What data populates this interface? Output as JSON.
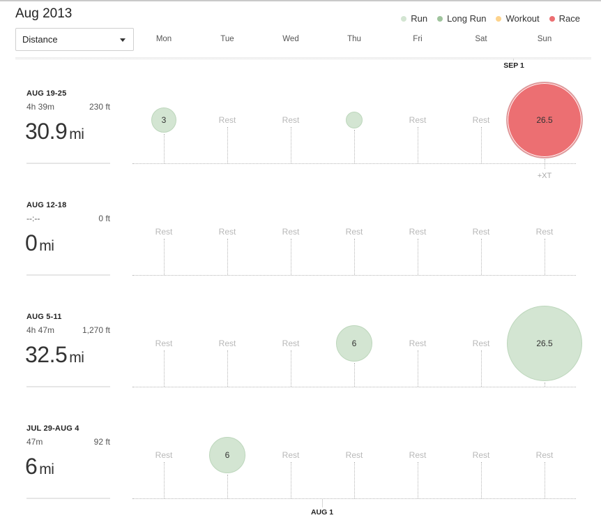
{
  "header": {
    "title": "Aug 2013",
    "metric_select": {
      "value": "Distance",
      "icon": "caret-down-icon"
    },
    "days": [
      "Mon",
      "Tue",
      "Wed",
      "Thu",
      "Fri",
      "Sat",
      "Sun"
    ]
  },
  "legend": [
    {
      "label": "Run",
      "color": "#d3e5d2"
    },
    {
      "label": "Long Run",
      "color": "#9fc49d"
    },
    {
      "label": "Workout",
      "color": "#fdd38c"
    },
    {
      "label": "Race",
      "color": "#ec6f72"
    }
  ],
  "markers": {
    "top": "SEP 1",
    "bottom": "AUG 1"
  },
  "rest_label": "Rest",
  "weeks": [
    {
      "range": "AUG 19-25",
      "time": "4h 39m",
      "elevation": "230 ft",
      "total": "30.9",
      "unit": "mi",
      "days": [
        {
          "type": "run",
          "value": "3",
          "distance": 3
        },
        {
          "type": "rest"
        },
        {
          "type": "rest"
        },
        {
          "type": "run",
          "value": "",
          "distance": 1.4
        },
        {
          "type": "rest"
        },
        {
          "type": "rest"
        },
        {
          "type": "race",
          "value": "26.5",
          "distance": 26.5,
          "extra": "+XT"
        }
      ]
    },
    {
      "range": "AUG 12-18",
      "time": "--:--",
      "elevation": "0 ft",
      "total": "0",
      "unit": "mi",
      "days": [
        {
          "type": "rest"
        },
        {
          "type": "rest"
        },
        {
          "type": "rest"
        },
        {
          "type": "rest"
        },
        {
          "type": "rest"
        },
        {
          "type": "rest"
        },
        {
          "type": "rest"
        }
      ]
    },
    {
      "range": "AUG 5-11",
      "time": "4h 47m",
      "elevation": "1,270 ft",
      "total": "32.5",
      "unit": "mi",
      "days": [
        {
          "type": "rest"
        },
        {
          "type": "rest"
        },
        {
          "type": "rest"
        },
        {
          "type": "run",
          "value": "6",
          "distance": 6
        },
        {
          "type": "rest"
        },
        {
          "type": "rest"
        },
        {
          "type": "run",
          "value": "26.5",
          "distance": 26.5
        }
      ]
    },
    {
      "range": "JUL 29-AUG 4",
      "time": "47m",
      "elevation": "92 ft",
      "total": "6",
      "unit": "mi",
      "days": [
        {
          "type": "rest"
        },
        {
          "type": "run",
          "value": "6",
          "distance": 6
        },
        {
          "type": "rest"
        },
        {
          "type": "rest"
        },
        {
          "type": "rest"
        },
        {
          "type": "rest"
        },
        {
          "type": "rest"
        }
      ]
    }
  ]
}
